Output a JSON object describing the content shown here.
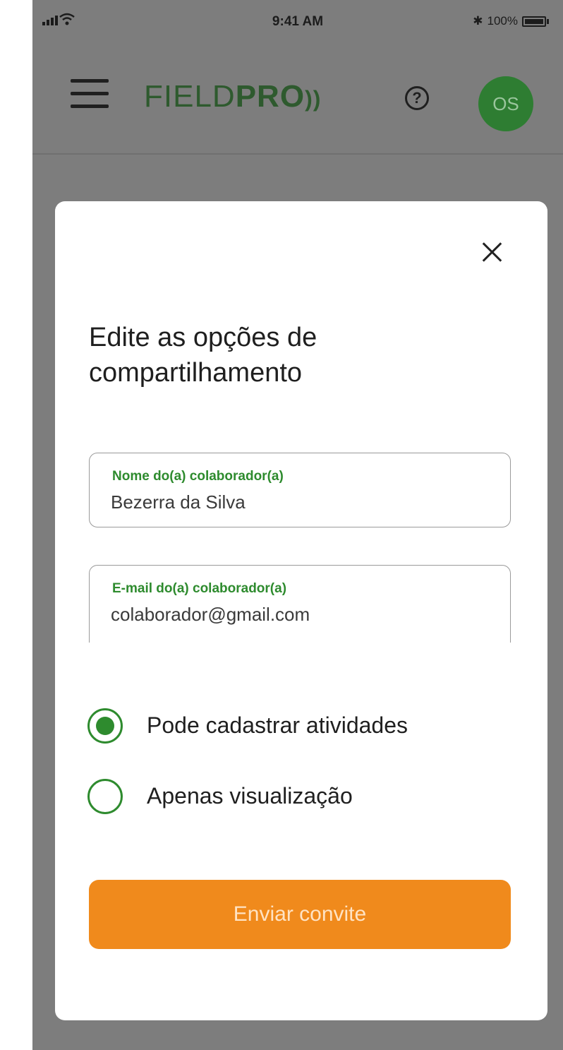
{
  "status_bar": {
    "time": "9:41 AM",
    "bluetooth": "✱",
    "battery_label": "100%",
    "signal_icon": "signal-icon",
    "wifi_icon": "wifi-icon",
    "battery_icon": "battery-icon"
  },
  "app_bar": {
    "brand_field": "FIELD",
    "brand_pro": "PRO",
    "brand_wave": "))",
    "help_label": "?",
    "avatar_initials": "OS",
    "menu_icon": "menu-icon"
  },
  "modal": {
    "close_icon": "close-icon",
    "title": "Edite as opções de compartilhamento",
    "name_field": {
      "label": "Nome do(a) colaborador(a)",
      "value": "Bezerra da Silva"
    },
    "email_field": {
      "label": "E-mail do(a) colaborador(a)",
      "value": "colaborador@gmail.com"
    },
    "options": [
      {
        "label": "Pode cadastrar atividades",
        "selected": true
      },
      {
        "label": "Apenas visualização",
        "selected": false
      }
    ],
    "submit_label": "Enviar convite"
  },
  "colors": {
    "brand_green": "#2e7d32",
    "accent_orange": "#f08a1c",
    "overlay_gray": "#7d7d7d"
  }
}
